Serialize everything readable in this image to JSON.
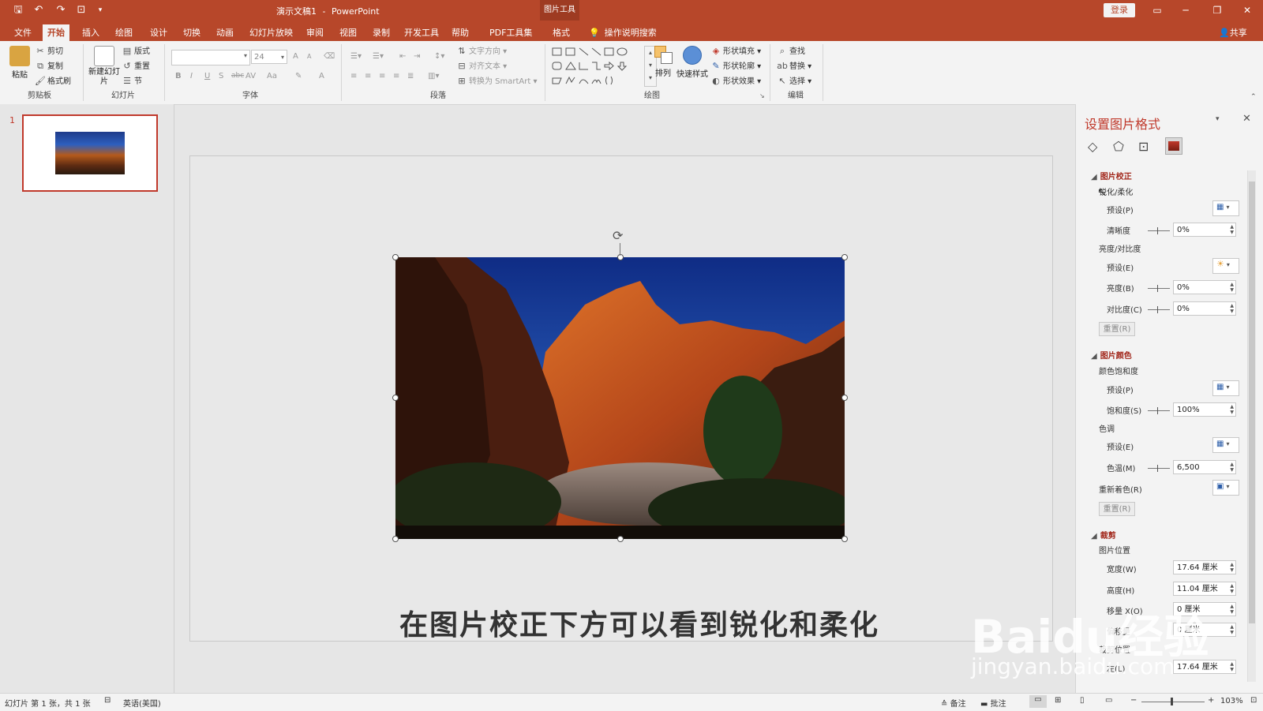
{
  "window": {
    "doc_title": "演示文稿1",
    "app_name": "PowerPoint",
    "context_tab_group": "图片工具",
    "login": "登录",
    "share": "共享",
    "minimize": "─",
    "restore": "❐",
    "close": "✕"
  },
  "tabs": [
    "文件",
    "开始",
    "插入",
    "绘图",
    "设计",
    "切换",
    "动画",
    "幻灯片放映",
    "审阅",
    "视图",
    "录制",
    "开发工具",
    "帮助",
    "PDF工具集",
    "格式"
  ],
  "active_tab": "开始",
  "tellme": "操作说明搜索",
  "ribbon": {
    "clipboard": {
      "label": "剪贴板",
      "paste": "粘贴",
      "cut": "剪切",
      "copy": "复制",
      "format_painter": "格式刷"
    },
    "slides": {
      "label": "幻灯片",
      "new_slide": "新建幻灯片",
      "layout": "版式",
      "reset": "重置",
      "section": "节"
    },
    "font": {
      "label": "字体",
      "font_name": "",
      "font_size": "24",
      "bold": "B",
      "italic": "I",
      "underline": "U",
      "shadow": "S",
      "strike": "abc",
      "char_spacing": "AV",
      "case": "Aa",
      "grow": "A",
      "shrink": "A",
      "color": "A"
    },
    "paragraph": {
      "label": "段落",
      "text_direction": "文字方向",
      "align_text": "对齐文本",
      "smartart": "转换为 SmartArt"
    },
    "drawing": {
      "label": "绘图",
      "arrange": "排列",
      "quick_styles": "快速样式",
      "shape_fill": "形状填充",
      "shape_outline": "形状轮廓",
      "shape_effects": "形状效果"
    },
    "editing": {
      "label": "编辑",
      "find": "查找",
      "replace": "替换",
      "select": "选择"
    }
  },
  "slide_panel": {
    "number": "1"
  },
  "slide": {
    "caption": "在图片校正下方可以看到锐化和柔化"
  },
  "format_pane": {
    "title": "设置图片格式",
    "section_correction": "图片校正",
    "sharpen_soften": "锐化/柔化",
    "preset_p": "预设(P)",
    "sharpness": "清晰度",
    "sharpness_value": "0%",
    "brightness_contrast": "亮度/对比度",
    "preset_e": "预设(E)",
    "brightness": "亮度(B)",
    "brightness_value": "0%",
    "contrast": "对比度(C)",
    "contrast_value": "0%",
    "reset": "重置(R)",
    "section_color": "图片颜色",
    "color_saturation": "颜色饱和度",
    "preset_p2": "预设(P)",
    "saturation": "饱和度(S)",
    "saturation_value": "100%",
    "tone": "色调",
    "preset_e2": "预设(E)",
    "temperature": "色温(M)",
    "temperature_value": "6,500",
    "recolor": "重新着色(R)",
    "reset2": "重置(R)",
    "section_crop": "裁剪",
    "picture_position": "图片位置",
    "width": "宽度(W)",
    "width_value": "17.64 厘米",
    "height": "高度(H)",
    "height_value": "11.04 厘米",
    "offset_x": "移量 X(O)",
    "offset_x_value": "0 厘米",
    "offset_y": "偏移量",
    "offset_y_value": "0 厘米",
    "crop_position": "裁剪位置",
    "left": "左(L)",
    "left_value": "17.64 厘米"
  },
  "statusbar": {
    "slide_info": "幻灯片 第 1 张，共 1 张",
    "language": "英语(美国)",
    "notes": "备注",
    "comments": "批注",
    "zoom": "103%"
  },
  "watermark": {
    "brand": "Baidu经验",
    "url": "jingyan.baidu.com"
  },
  "colors": {
    "accent": "#b7472a",
    "section": "#a1261a",
    "selection": "#c0392b"
  }
}
